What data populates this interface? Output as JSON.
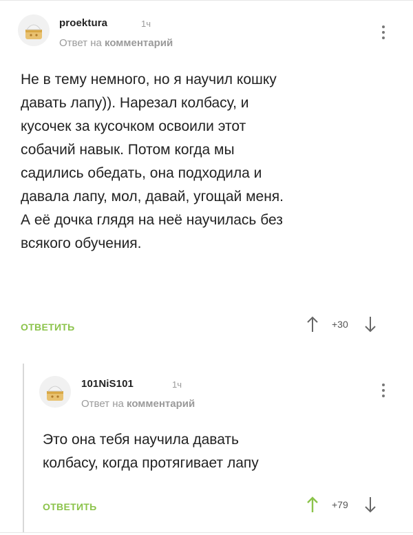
{
  "comments": [
    {
      "username": "proektura",
      "time": "1ч",
      "reply_prefix": "Ответ на",
      "reply_link": "комментарий",
      "text_lines": [
        "Не в тему немного, но я научил кошку",
        "давать лапу)). Нарезал колбасу, и",
        "кусочек за кусочком освоили этот",
        "собачий навык. Потом когда мы",
        "садились обедать, она подходила и",
        "давала лапу, мол, давай, угощай меня.",
        "А её дочка глядя на неё научилась без",
        "всякого обучения."
      ],
      "reply_label": "ОТВЕТИТЬ",
      "score": "+30",
      "upvoted": false
    },
    {
      "username": "101NiS101",
      "time": "1ч",
      "reply_prefix": "Ответ на",
      "reply_link": "комментарий",
      "text_lines": [
        "Это она тебя научила давать",
        "колбасу, когда протягивает лапу"
      ],
      "reply_label": "ОТВЕТИТЬ",
      "score": "+79",
      "upvoted": true
    }
  ],
  "colors": {
    "accent_green": "#8bc34a",
    "muted_text": "#9a9a9a",
    "main_text": "#222222",
    "arrow_default": "#666666"
  },
  "icons": {
    "avatar": "default-avatar-icon",
    "menu": "more-vertical-icon",
    "upvote": "arrow-up-icon",
    "downvote": "arrow-down-icon"
  }
}
